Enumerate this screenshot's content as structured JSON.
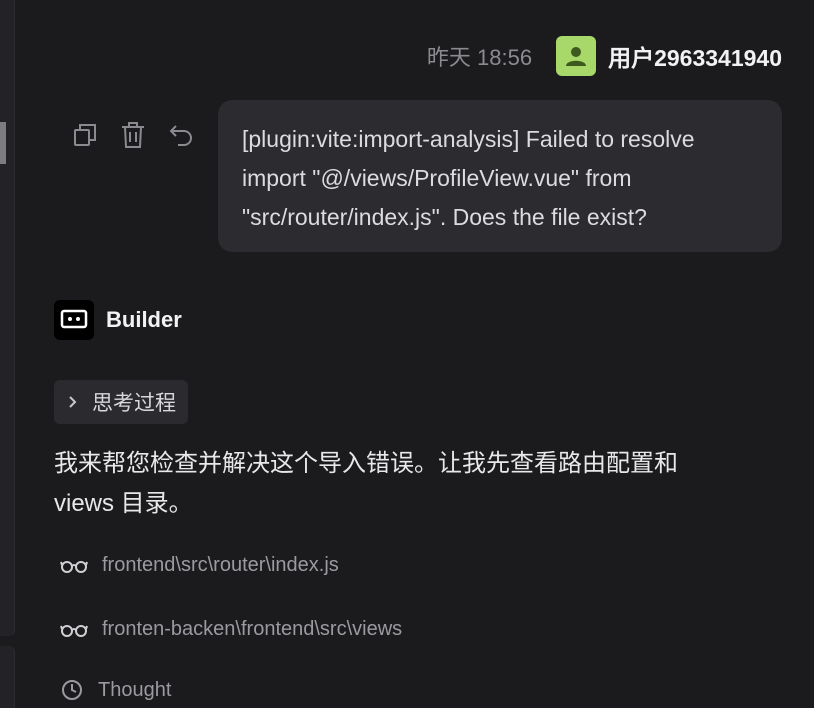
{
  "user_message": {
    "timestamp": "昨天 18:56",
    "username": "用户2963341940",
    "text": "[plugin:vite:import-analysis] Failed to resolve import \"@/views/ProfileView.vue\" from \"src/router/index.js\". Does the file exist?"
  },
  "actions": [
    {
      "icon": "copy-icon"
    },
    {
      "icon": "trash-icon"
    },
    {
      "icon": "undo-icon"
    }
  ],
  "assistant": {
    "name": "Builder",
    "thinking_label": "思考过程",
    "response_line1": "我来帮您检查并解决这个导入错误。让我先查看路由配置和",
    "response_line2": "views 目录。",
    "tools": [
      {
        "icon": "glasses-icon",
        "path": "frontend\\src\\router\\index.js"
      },
      {
        "icon": "glasses-icon",
        "path": "fronten-backen\\frontend\\src\\views"
      },
      {
        "icon": "clock-icon",
        "path": "Thought"
      }
    ]
  },
  "colors": {
    "background": "#1b1b1e",
    "bubble": "#2b2b30",
    "avatar": "#a9d86a"
  }
}
